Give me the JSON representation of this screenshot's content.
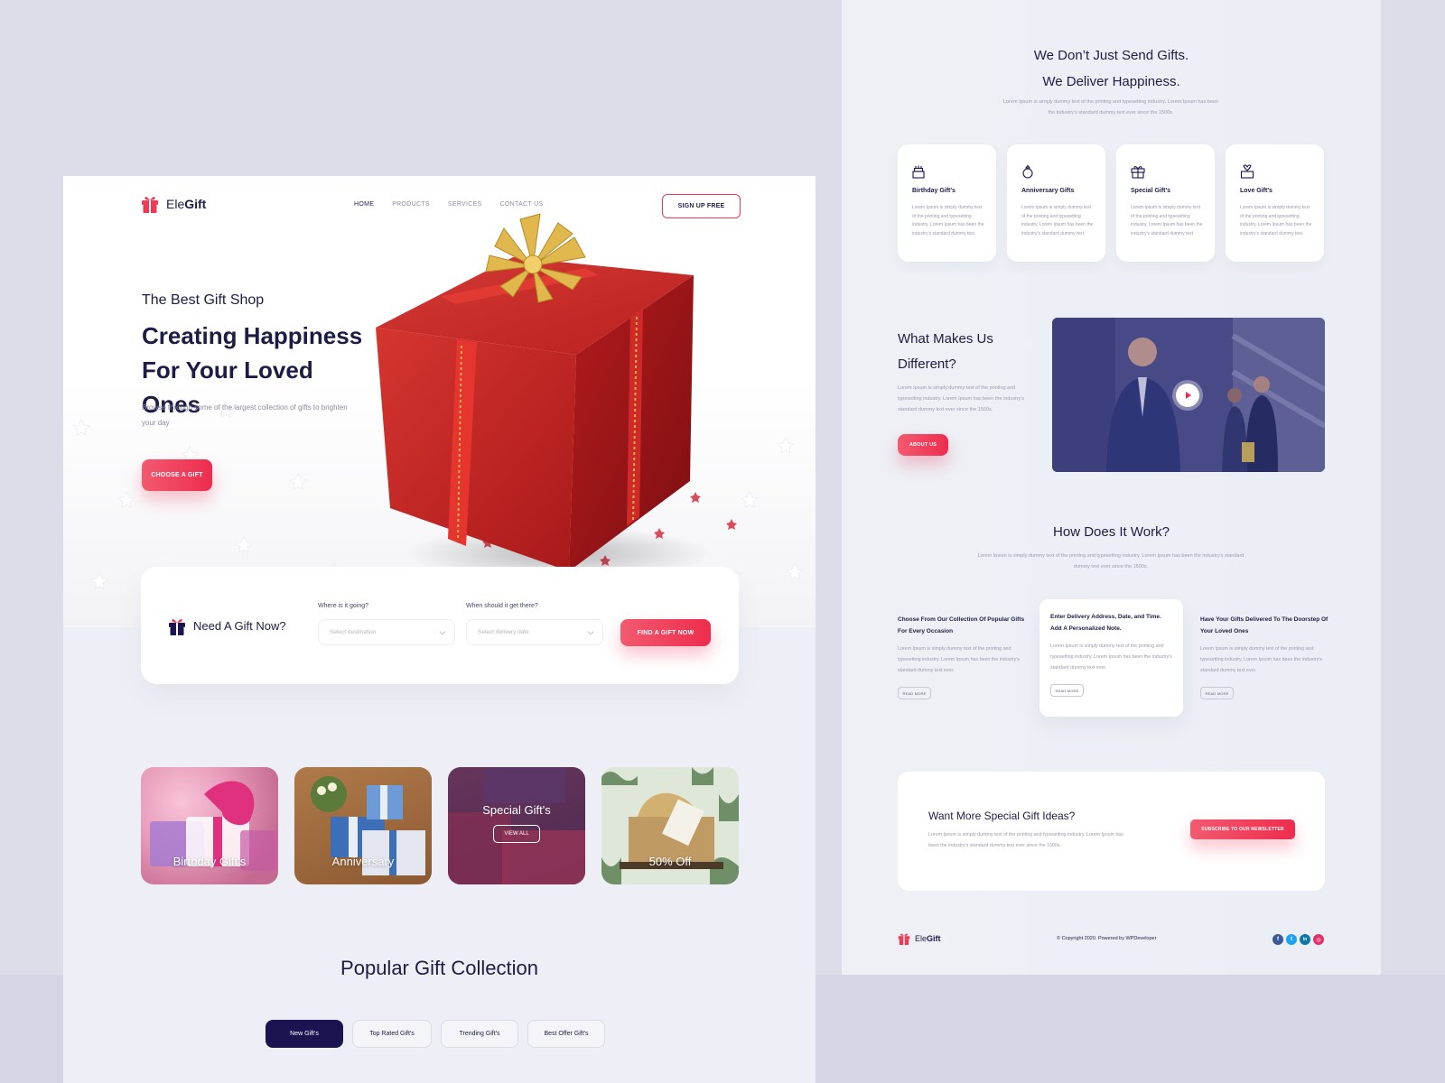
{
  "brand": {
    "name_pre": "Ele",
    "name_bold": "Gift",
    "accent": "#ee2c4e",
    "navy": "#1a1550"
  },
  "nav": {
    "items": [
      {
        "label": "HOME",
        "active": true
      },
      {
        "label": "PRODUCTS"
      },
      {
        "label": "SERVICES"
      },
      {
        "label": "CONTACT US"
      }
    ],
    "signup_label": "SIGN UP FREE"
  },
  "hero": {
    "subtitle": "The Best Gift Shop",
    "title": "Creating Happiness For Your Loved Ones",
    "description": "Browse through some of the largest collection of gifts to brighten your day",
    "cta": "CHOOSE A GIFT"
  },
  "search": {
    "title": "Need A Gift Now?",
    "where_label": "Where is it going?",
    "where_placeholder": "Select destination",
    "when_label": "When should it get there?",
    "when_placeholder": "Select delivery date",
    "button": "FIND A GIFT NOW"
  },
  "categories": [
    {
      "label": "Birthday Gift's",
      "icon": "birthday-gift-image"
    },
    {
      "label": "Anniversary",
      "icon": "anniversary-gift-image"
    },
    {
      "label": "Special Gift's",
      "action": "VIEW ALL",
      "icon": "special-gift-image"
    },
    {
      "label": "50% Off",
      "icon": "discount-gift-image"
    }
  ],
  "popular": {
    "title": "Popular Gift Collection",
    "tabs": [
      {
        "label": "New Gift's",
        "active": true
      },
      {
        "label": "Top Rated Gift's"
      },
      {
        "label": "Trending Gift's"
      },
      {
        "label": "Best Offer Gift's"
      }
    ]
  },
  "intro": {
    "line1": "We Don’t Just Send Gifts.",
    "line2": "We Deliver Happiness.",
    "text": "Lorem Ipsum is simply dummy text of the printing and typesetting industry. Lorem Ipsum has been the industry's standard dummy text ever since the 1500s."
  },
  "services": [
    {
      "title": "Birthday Gift's",
      "icon": "cake-icon",
      "text": "Lorem Ipsum is simply dummy text of the printing and typesetting industry. Lorem Ipsum has been the industry's standard dummy text."
    },
    {
      "title": "Anniversary Gifts",
      "icon": "ring-icon",
      "text": "Lorem Ipsum is simply dummy text of the printing and typesetting industry. Lorem Ipsum has been the industry's standard dummy text."
    },
    {
      "title": "Special Gift's",
      "icon": "gift-icon",
      "text": "Lorem Ipsum is simply dummy text of the printing and typesetting industry. Lorem Ipsum has been the industry's standard dummy text."
    },
    {
      "title": "Love Gift's",
      "icon": "heart-gift-icon",
      "text": "Lorem Ipsum is simply dummy text of the printing and typesetting industry. Lorem Ipsum has been the industry's standard dummy text."
    }
  ],
  "different": {
    "title_line1": "What Makes Us",
    "title_line2": "Different?",
    "text": "Lorem Ipsum is simply dummy text of the printing and typesetting industry. Lorem Ipsum has been the industry's standard dummy text ever since the 1500s.",
    "button": "ABOUT US"
  },
  "how": {
    "title": "How Does It Work?",
    "text": "Lorem Ipsum is simply dummy text of the printing and typesetting industry. Lorem Ipsum has been the industry's standard dummy text ever since the 1500s.",
    "steps": [
      {
        "title": "Choose From Our Collection Of Popular Gifts For Every Occasion",
        "text": "Lorem Ipsum is simply dummy text of the printing and typesetting industry. Lorem Ipsum has been the industry's standard dummy text ever.",
        "button": "READ MORE"
      },
      {
        "title": "Enter Delivery Address, Date, and Time. Add A Personalized Note.",
        "text": "Lorem Ipsum is simply dummy text of the printing and typesetting industry. Lorem Ipsum has been the industry's standard dummy text ever.",
        "button": "READ MORE"
      },
      {
        "title": "Have Your Gifts Delivered To The Doorstep Of Your Loved Ones",
        "text": "Lorem Ipsum is simply dummy text of the printing and typesetting industry. Lorem Ipsum has been the industry's standard dummy text ever.",
        "button": "READ MORE"
      }
    ]
  },
  "newsletter": {
    "title": "Want More Special Gift Ideas?",
    "text": "Lorem Ipsum is simply dummy text of the printing and typesetting industry. Lorem Ipsum has been the industry's standard dummy text ever since the 1500s.",
    "button": "SUBSCRIBE TO OUR NEWSLETTER"
  },
  "footer": {
    "copyright": "© Copyright 2020. Powered by WPDeveloper",
    "socials": [
      {
        "icon": "facebook-icon",
        "glyph": "f",
        "color": "#3b5998"
      },
      {
        "icon": "twitter-icon",
        "glyph": "t",
        "color": "#1da1f2"
      },
      {
        "icon": "linkedin-icon",
        "glyph": "in",
        "color": "#0e76a8"
      },
      {
        "icon": "instagram-icon",
        "glyph": "◎",
        "color": "#e1306c"
      }
    ]
  }
}
